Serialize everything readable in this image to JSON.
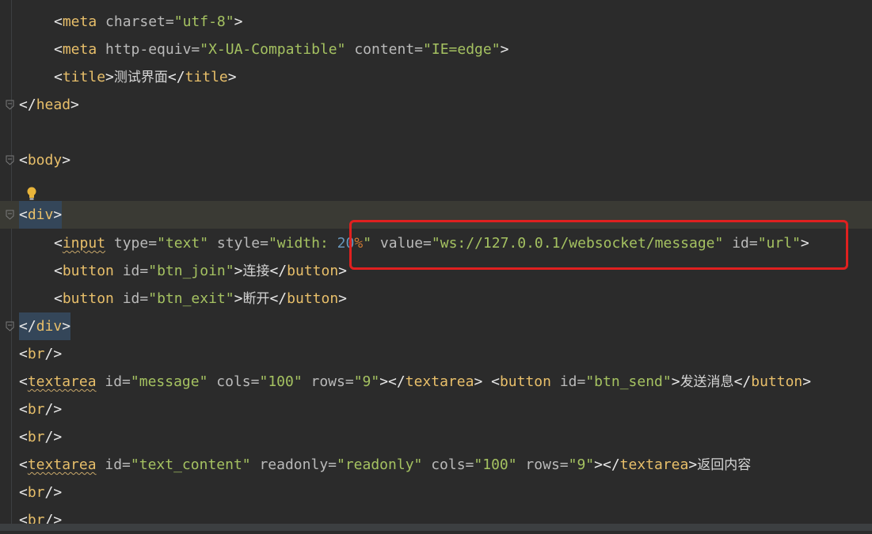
{
  "editor": {
    "lines": [
      {
        "id": "meta-charset",
        "tokens": [
          "<",
          "meta",
          " charset=",
          "\"utf-8\"",
          ">"
        ]
      },
      {
        "id": "meta-http-equiv",
        "tokens": [
          "<",
          "meta",
          " http-equiv=",
          "\"X-UA-Compatible\"",
          " content=",
          "\"IE=edge\"",
          ">"
        ]
      },
      {
        "id": "title",
        "tokens": [
          "<",
          "title",
          ">",
          "测试界面",
          "</",
          "title",
          ">"
        ]
      },
      {
        "id": "head-close",
        "tokens": [
          "</",
          "head",
          ">"
        ]
      },
      {
        "id": "body-open",
        "tokens": [
          "<",
          "body",
          ">"
        ]
      },
      {
        "id": "div-open",
        "tokens": [
          "<",
          "div",
          ">"
        ]
      },
      {
        "id": "input",
        "tokens": [
          "<",
          "input",
          " type=",
          "\"text\"",
          " style=",
          "\"width: ",
          "20",
          "%",
          "\"",
          " value=",
          "\"ws://127.0.0.1/websocket/message\"",
          " id=",
          "\"url\"",
          ">"
        ]
      },
      {
        "id": "btn-join",
        "tokens": [
          "<",
          "button",
          " id=",
          "\"btn_join\"",
          ">",
          "连接",
          "</",
          "button",
          ">"
        ]
      },
      {
        "id": "btn-exit",
        "tokens": [
          "<",
          "button",
          " id=",
          "\"btn_exit\"",
          ">",
          "断开",
          "</",
          "button",
          ">"
        ]
      },
      {
        "id": "div-close",
        "tokens": [
          "</",
          "div",
          ">"
        ]
      },
      {
        "id": "br-1",
        "tokens": [
          "<",
          "br",
          "/>"
        ]
      },
      {
        "id": "textarea-message",
        "tokens": [
          "<",
          "textarea",
          " id=",
          "\"message\"",
          " cols=",
          "\"100\"",
          " rows=",
          "\"9\"",
          "></",
          "textarea",
          "> <",
          "button",
          " id=",
          "\"btn_send\"",
          ">",
          "发送消息",
          "</",
          "button",
          ">"
        ]
      },
      {
        "id": "br-2",
        "tokens": [
          "<",
          "br",
          "/>"
        ]
      },
      {
        "id": "br-3",
        "tokens": [
          "<",
          "br",
          "/>"
        ]
      },
      {
        "id": "textarea-content",
        "tokens": [
          "<",
          "textarea",
          " id=",
          "\"text_content\"",
          " readonly=",
          "\"readonly\"",
          " cols=",
          "\"100\"",
          " rows=",
          "\"9\"",
          "></",
          "textarea",
          ">",
          "返回内容"
        ]
      },
      {
        "id": "br-4",
        "tokens": [
          "<",
          "br",
          "/>"
        ]
      },
      {
        "id": "br-5",
        "tokens": [
          "<",
          "br",
          "/>"
        ]
      }
    ]
  },
  "colors": {
    "background": "#2b2b2b",
    "tag": "#e8bf6a",
    "attr_value": "#a5c261",
    "highlight_box": "#e0201f",
    "current_line": "#3a3a34"
  }
}
